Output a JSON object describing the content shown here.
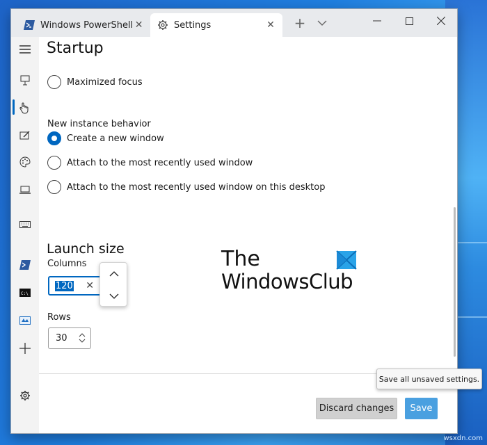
{
  "tabs": [
    {
      "label": "Windows PowerShell",
      "icon": "powershell-icon",
      "active": false
    },
    {
      "label": "Settings",
      "icon": "gear-icon",
      "active": true
    }
  ],
  "titlebar": {
    "new_tab_symbol": "+",
    "dropdown_icon": "chevron-down-icon",
    "close_tab_symbol": "✕"
  },
  "window_controls": {
    "minimize": "—",
    "maximize": "☐",
    "close": "✕"
  },
  "page": {
    "title": "Startup"
  },
  "startup": {
    "maximized_focus_label": "Maximized focus",
    "new_instance_label": "New instance behavior",
    "options": [
      {
        "label": "Create a new window",
        "checked": true
      },
      {
        "label": "Attach to the most recently used window",
        "checked": false
      },
      {
        "label": "Attach to the most recently used window on this desktop",
        "checked": false
      }
    ]
  },
  "launch_size": {
    "title": "Launch size",
    "columns_label": "Columns",
    "columns_value": "120",
    "rows_label": "Rows",
    "rows_value": "30"
  },
  "footer": {
    "discard_label": "Discard changes",
    "save_label": "Save",
    "save_tooltip": "Save all unsaved settings."
  },
  "watermark": {
    "line1": "The",
    "line2": "WindowsClub"
  },
  "site": "wsxdn.com",
  "colors": {
    "accent": "#0067c0",
    "save_button": "#4aa0e0"
  }
}
